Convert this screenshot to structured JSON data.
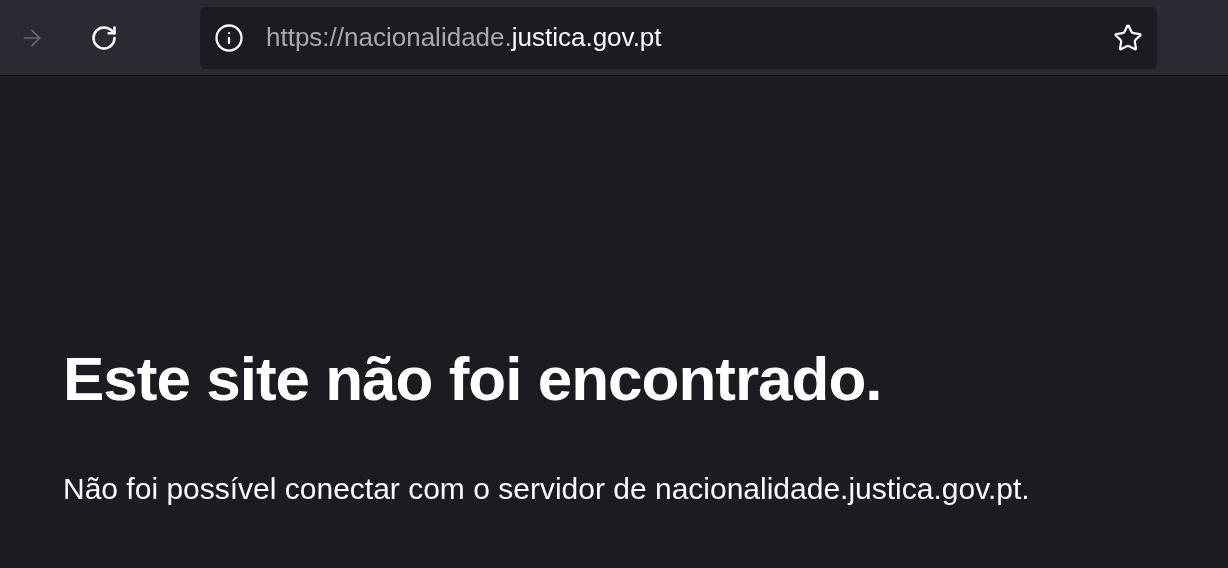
{
  "toolbar": {
    "forward_button": {
      "disabled": true
    },
    "address_bar": {
      "url_prefix": "https://nacionalidade.",
      "url_domain": "justica.gov.pt"
    }
  },
  "error_page": {
    "title": "Este site não foi encontrado.",
    "message": "Não foi possível conectar com o servidor de nacionalidade.justica.gov.pt."
  }
}
